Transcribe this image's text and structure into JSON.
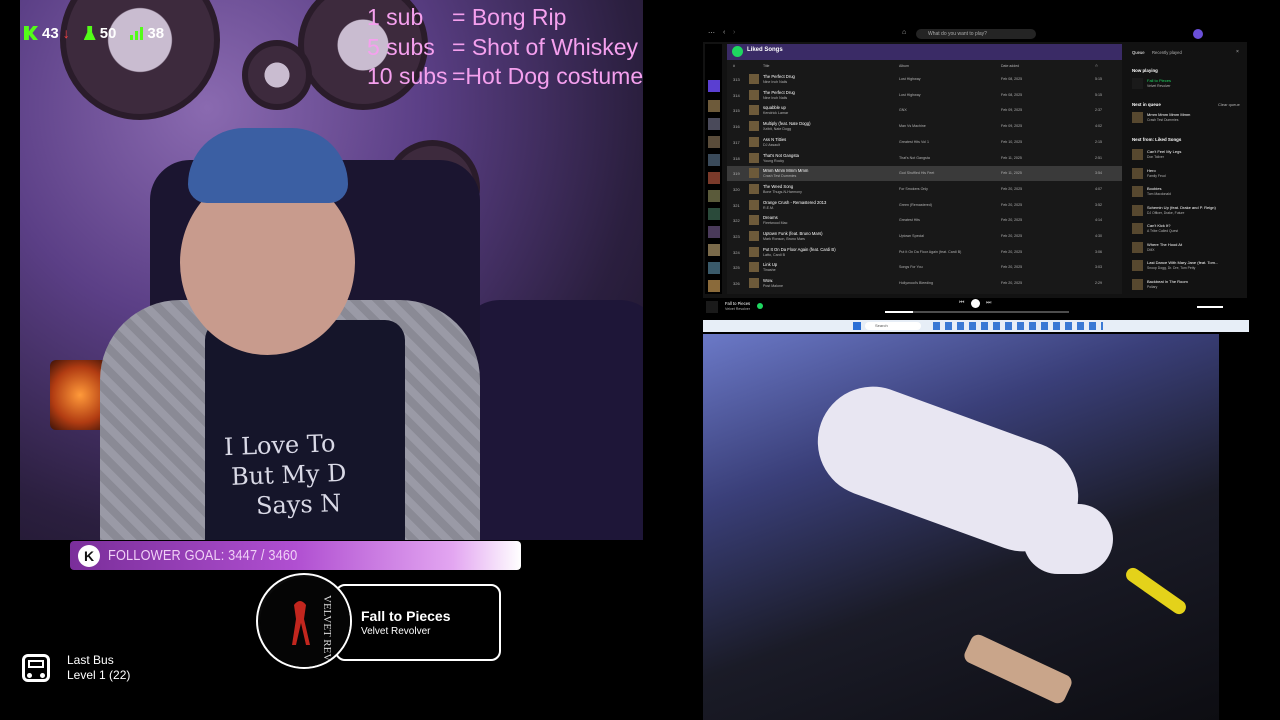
{
  "stream_stats": {
    "viewers": "43",
    "followers": "50",
    "subs": "38"
  },
  "sub_goals": [
    {
      "count": "1 sub",
      "reward": "= Bong Rip"
    },
    {
      "count": "5 subs",
      "reward": "= Shot of Whiskey"
    },
    {
      "count": "10 subs",
      "reward": "=Hot Dog costume"
    }
  ],
  "follower_goal": {
    "label": "FOLLOWER GOAL: 3447 / 3460",
    "progress": 0.996,
    "colors": {
      "start": "#7a2e9a",
      "end": "#ffffff"
    }
  },
  "now_playing": {
    "title": "Fall to Pieces",
    "artist": "Velvet Revolver"
  },
  "last_bus": {
    "name": "Last Bus",
    "level": "Level 1  (22)"
  },
  "webcam_shirt_text": [
    "I Love To",
    "But My D",
    "Says N"
  ],
  "spotify": {
    "search_placeholder": "What do you want to play?",
    "playlist_title": "Liked Songs",
    "columns": [
      "#",
      "Title",
      "Album",
      "Date added",
      "⏱"
    ],
    "rows": [
      {
        "num": "313",
        "title": "The Perfect Drug",
        "artist": "Nine Inch Nails",
        "album": "Lost Highway",
        "date": "Feb 08, 2025",
        "duration": "5:15"
      },
      {
        "num": "314",
        "title": "The Perfect Drug",
        "artist": "Nine Inch Nails",
        "album": "Lost Highway",
        "date": "Feb 08, 2025",
        "duration": "5:15"
      },
      {
        "num": "315",
        "title": "squabble up",
        "artist": "Kendrick Lamar",
        "album": "GNX",
        "date": "Feb 09, 2025",
        "duration": "2:37"
      },
      {
        "num": "316",
        "title": "Multiply (feat. Nate Dogg)",
        "artist": "Xzibit, Nate Dogg",
        "album": "Man Vs Machine",
        "date": "Feb 09, 2025",
        "duration": "4:02"
      },
      {
        "num": "317",
        "title": "Ass N Titties",
        "artist": "DJ Assault",
        "album": "Greatest Hits Vol 1",
        "date": "Feb 10, 2025",
        "duration": "2:15"
      },
      {
        "num": "318",
        "title": "That's Not Gangsta",
        "artist": "Young Rocky",
        "album": "That's Not Gangsta",
        "date": "Feb 11, 2025",
        "duration": "2:51"
      },
      {
        "num": "319",
        "title": "Mmm Mmm Mmm Mmm",
        "artist": "Crash Test Dummies",
        "album": "God Shuffled His Feet",
        "date": "Feb 11, 2025",
        "duration": "3:54",
        "active": true
      },
      {
        "num": "320",
        "title": "The Weed Song",
        "artist": "Bone Thugs-N-Harmony",
        "album": "For Smokers Only",
        "date": "Feb 20, 2025",
        "duration": "4:07"
      },
      {
        "num": "321",
        "title": "Orange Crush - Remastered 2013",
        "artist": "R.E.M.",
        "album": "Green (Remastered)",
        "date": "Feb 20, 2025",
        "duration": "3:52"
      },
      {
        "num": "322",
        "title": "Dreams",
        "artist": "Fleetwood Mac",
        "album": "Greatest Hits",
        "date": "Feb 20, 2025",
        "duration": "4:14"
      },
      {
        "num": "323",
        "title": "Uptown Funk (feat. Bruno Mars)",
        "artist": "Mark Ronson, Bruno Mars",
        "album": "Uptown Special",
        "date": "Feb 20, 2025",
        "duration": "4:30"
      },
      {
        "num": "324",
        "title": "Put It On Da Floor Again (feat. Cardi B)",
        "artist": "Latto, Cardi B",
        "album": "Put It On Da Floor Again (feat. Cardi B)",
        "date": "Feb 20, 2025",
        "duration": "3:06"
      },
      {
        "num": "325",
        "title": "Link Up",
        "artist": "Tinashe",
        "album": "Songs For You",
        "date": "Feb 20, 2025",
        "duration": "3:03"
      },
      {
        "num": "326",
        "title": "Wow.",
        "artist": "Post Malone",
        "album": "Hollywood's Bleeding",
        "date": "Feb 20, 2025",
        "duration": "2:29"
      }
    ],
    "queue_tabs": [
      "Queue",
      "Recently played"
    ],
    "now_playing_label": "Now playing",
    "now_playing_item": {
      "title": "Fall to Pieces",
      "artist": "Velvet Revolver"
    },
    "next_in_queue_label": "Next in queue",
    "clear_queue": "Clear queue",
    "next_in_queue_item": {
      "title": "Mmm Mmm Mmm Mmm",
      "artist": "Crash Test Dummies"
    },
    "next_from_label": "Next from: Liked Songs",
    "next_from_items": [
      {
        "title": "Can't Feel My Legs",
        "artist": "Don Toliver"
      },
      {
        "title": "Hero",
        "artist": "Family Feud"
      },
      {
        "title": "Boobies",
        "artist": "Tom Macdonald"
      },
      {
        "title": "Schemin Up (feat. Drake and P. Reign)",
        "artist": "DJ Officer, Drake, Future"
      },
      {
        "title": "Can't Kick It?",
        "artist": "A Tribe Called Quest"
      },
      {
        "title": "Where The Hood At",
        "artist": "DMX"
      },
      {
        "title": "Last Dance With Mary Jane (feat. Tom...",
        "artist": "Snoop Dogg, Dr. Dre, Tom Petty"
      },
      {
        "title": "Backbeat In The Room",
        "artist": "Poliary"
      }
    ],
    "player": {
      "title": "Fall to Pieces",
      "artist": "Velvet Revolver"
    }
  },
  "taskbar": {
    "search_placeholder": "Search"
  }
}
